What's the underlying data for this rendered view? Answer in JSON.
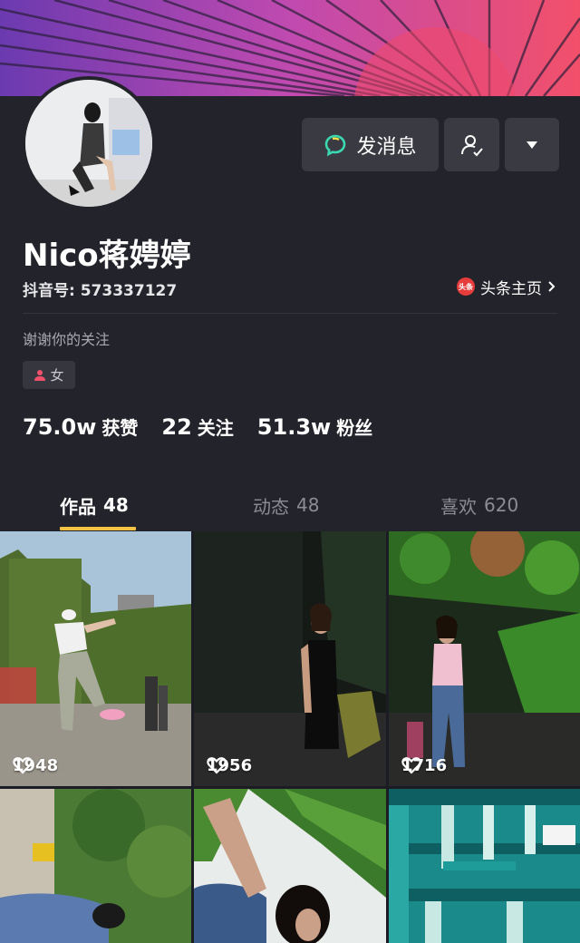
{
  "profile": {
    "nickname": "Nico蒋娉婷",
    "douyin_id": "抖音号: 573337127",
    "signature": "谢谢你的关注",
    "gender": "女",
    "toutiao_badge": "头条",
    "toutiao_link": "头条主页"
  },
  "actions": {
    "message_label": "发消息"
  },
  "stats": [
    {
      "value": "75.0w",
      "label": "获赞"
    },
    {
      "value": "22",
      "label": "关注"
    },
    {
      "value": "51.3w",
      "label": "粉丝"
    }
  ],
  "tabs": [
    {
      "label": "作品",
      "count": "48",
      "active": true
    },
    {
      "label": "动态",
      "count": "48",
      "active": false
    },
    {
      "label": "喜欢",
      "count": "620",
      "active": false
    }
  ],
  "videos": [
    {
      "likes": "1948"
    },
    {
      "likes": "1956"
    },
    {
      "likes": "1716"
    },
    {
      "likes": ""
    },
    {
      "likes": ""
    },
    {
      "likes": ""
    }
  ],
  "colors": {
    "background": "#23232b",
    "accent_tab": "#f6c243",
    "button": "#3a3a42",
    "message_icon": "#3ad8b0"
  }
}
